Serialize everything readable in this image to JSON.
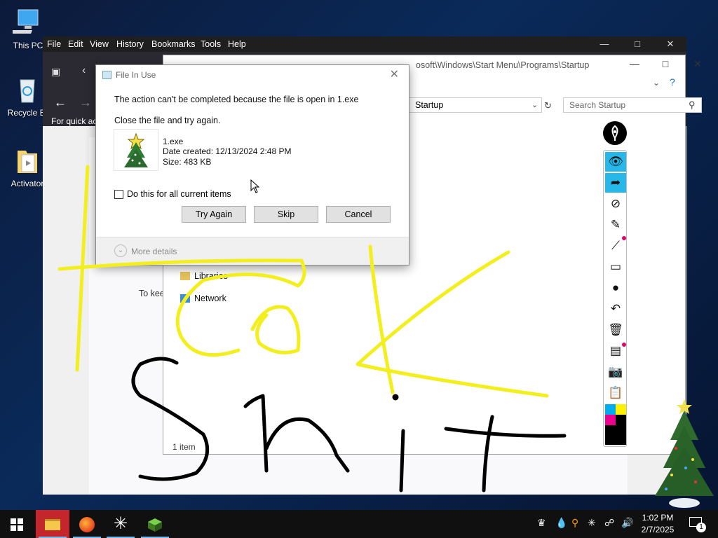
{
  "desktop": {
    "icons": [
      {
        "label": "This PC",
        "icon": "computer-icon"
      },
      {
        "label": "Recycle Bi",
        "icon": "recycle-bin-icon"
      },
      {
        "label": "Activator",
        "icon": "folder-icon"
      }
    ]
  },
  "browser": {
    "menu": [
      "File",
      "Edit",
      "View",
      "History",
      "Bookmarks",
      "Tools",
      "Help"
    ],
    "content_text": "For quick ac",
    "content_text_2": "To kee"
  },
  "explorer": {
    "title_path": "C:\\Users\\User\\AppData\\Roaming\\Microsoft\\Windows\\Start Menu\\Programs\\Startup",
    "title_path_visible": "osoft\\Windows\\Start Menu\\Programs\\Startup",
    "address": "Startup",
    "search_placeholder": "Search Startup",
    "nav": [
      {
        "label": "Libraries",
        "icon": "libraries-icon"
      },
      {
        "label": "Network",
        "icon": "network-icon"
      }
    ],
    "status": "1 item"
  },
  "dialog": {
    "title": "File In Use",
    "message": "The action can't be completed because the file is open in 1.exe",
    "instruction": "Close the file and try again.",
    "file_name": "1.exe",
    "date_created": "Date created: 12/13/2024 2:48 PM",
    "size": "Size: 483 KB",
    "checkbox_label": "Do this for all current items",
    "checkbox_checked": false,
    "buttons": {
      "try_again": "Try Again",
      "skip": "Skip",
      "cancel": "Cancel"
    },
    "more_details": "More details"
  },
  "annotation_tools": [
    "eye-icon",
    "pointer-icon",
    "lasso-icon",
    "marker-icon",
    "line-icon",
    "eraser-icon",
    "dot-icon",
    "undo-icon",
    "trash-icon",
    "whiteboard-icon",
    "camera-icon",
    "clipboard-icon"
  ],
  "annotation_colors": {
    "active_tool": "#27b7e8",
    "swatches": [
      "#00aeef",
      "#fff200",
      "#ec008c",
      "#000000"
    ]
  },
  "ink": {
    "yellow_color": "#f3ef1f",
    "black_color": "#000000"
  },
  "taskbar": {
    "apps": [
      "file-explorer-icon",
      "firefox-icon",
      "asterisk-app-icon",
      "cube-app-icon"
    ],
    "clock_time": "1:02 PM",
    "clock_date": "2/7/2025",
    "notification_count": "1"
  }
}
